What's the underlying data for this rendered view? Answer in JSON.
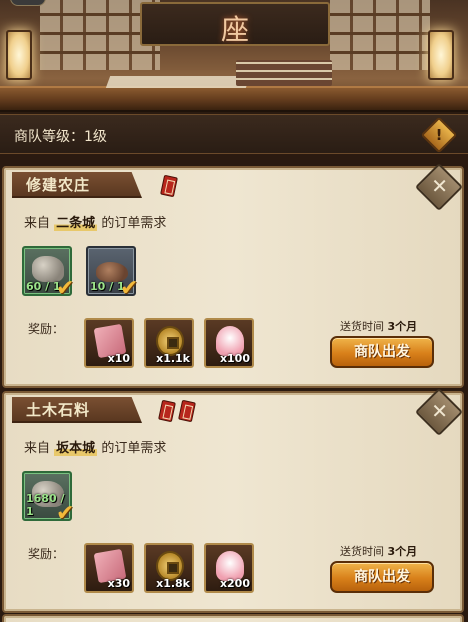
{
  "scene": {
    "sign_char": "座"
  },
  "level_bar": {
    "text": "商队等级：1级",
    "warn_icon": "exclamation-diamond-icon",
    "warn_mark": "!"
  },
  "orders": [
    {
      "title": "修建农庄",
      "tag_count": 1,
      "from_prefix": "来自",
      "city": "二条城",
      "from_suffix": "的订单需求",
      "items": [
        {
          "icon": "stone-icon",
          "count": "60 / 1",
          "fulfilled": true
        },
        {
          "icon": "boar-icon",
          "count": "10 / 1",
          "fulfilled": true
        }
      ],
      "reward_label": "奖励：",
      "rewards": [
        {
          "icon": "ticket-icon",
          "count": "x10"
        },
        {
          "icon": "coin-icon",
          "count": "x1.1k"
        },
        {
          "icon": "charm-icon",
          "count": "x100"
        }
      ],
      "ship_label": "送货时间",
      "ship_time": "3个月",
      "button": "商队出发"
    },
    {
      "title": "土木石料",
      "tag_count": 2,
      "from_prefix": "来自",
      "city": "坂本城",
      "from_suffix": "的订单需求",
      "items": [
        {
          "icon": "stone-icon",
          "count": "1680 / 1",
          "fulfilled": true
        }
      ],
      "reward_label": "奖励：",
      "rewards": [
        {
          "icon": "ticket-icon",
          "count": "x30"
        },
        {
          "icon": "coin-icon",
          "count": "x1.8k"
        },
        {
          "icon": "charm-icon",
          "count": "x200"
        }
      ],
      "ship_label": "送货时间",
      "ship_time": "3个月",
      "button": "商队出发"
    }
  ],
  "check_glyph": "✔",
  "corner_glyph": "✕"
}
